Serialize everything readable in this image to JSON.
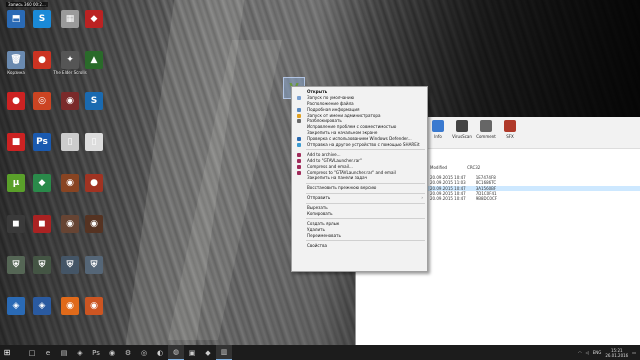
{
  "desktop": {
    "tooltip": "Запись 360 00:2...",
    "icons": [
      {
        "label": "",
        "color": "#2a6ab5",
        "glyph": "⬒"
      },
      {
        "label": "",
        "color": "#1a8ad8",
        "glyph": "S"
      },
      {
        "label": "",
        "color": "#9a9a9a",
        "glyph": "▦"
      },
      {
        "label": "",
        "color": "#bb2222",
        "glyph": "◆"
      },
      {
        "label": "Корзина",
        "color": "#6a8ab0",
        "glyph": "🗑"
      },
      {
        "label": "",
        "color": "#cc3322",
        "glyph": "●"
      },
      {
        "label": "The Elder Scrolls",
        "color": "#555",
        "glyph": "✦"
      },
      {
        "label": "",
        "color": "#2a6a2a",
        "glyph": "▲"
      },
      {
        "label": "",
        "color": "#cc2222",
        "glyph": "●"
      },
      {
        "label": "",
        "color": "#cc4422",
        "glyph": "◎"
      },
      {
        "label": "",
        "color": "#7a2a2a",
        "glyph": "◉"
      },
      {
        "label": "",
        "color": "#1a6ab0",
        "glyph": "S"
      },
      {
        "label": "",
        "color": "#cc2222",
        "glyph": "■"
      },
      {
        "label": "",
        "color": "#1a5ab0",
        "glyph": "Ps"
      },
      {
        "label": "",
        "color": "#cccccc",
        "glyph": "▯"
      },
      {
        "label": "",
        "color": "#dddddd",
        "glyph": "▯"
      },
      {
        "label": "",
        "color": "#5aa02a",
        "glyph": "μ"
      },
      {
        "label": "",
        "color": "#2a8a4a",
        "glyph": "◆"
      },
      {
        "label": "",
        "color": "#884422",
        "glyph": "◉"
      },
      {
        "label": "",
        "color": "#a03322",
        "glyph": "●"
      },
      {
        "label": "",
        "color": "#3a3a3a",
        "glyph": "◼"
      },
      {
        "label": "",
        "color": "#aa2222",
        "glyph": "◼"
      },
      {
        "label": "",
        "color": "#664433",
        "glyph": "◉"
      },
      {
        "label": "",
        "color": "#553322",
        "glyph": "◉"
      },
      {
        "label": "",
        "color": "#556655",
        "glyph": "⛨"
      },
      {
        "label": "",
        "color": "#445544",
        "glyph": "⛨"
      },
      {
        "label": "",
        "color": "#445566",
        "glyph": "⛨"
      },
      {
        "label": "",
        "color": "#556677",
        "glyph": "⛨"
      },
      {
        "label": "",
        "color": "#2a6ab5",
        "glyph": "◈"
      },
      {
        "label": "",
        "color": "#2a5aa0",
        "glyph": "◈"
      },
      {
        "label": "",
        "color": "#e06a1a",
        "glyph": "◉"
      },
      {
        "label": "",
        "color": "#cc5522",
        "glyph": "◉"
      }
    ]
  },
  "drag_ghost": {
    "glyph": "V"
  },
  "explorer": {
    "toolbar": [
      {
        "label": "Info",
        "color": "#3a7ad0"
      },
      {
        "label": "VirusScan",
        "color": "#444"
      },
      {
        "label": "Comment",
        "color": "#666"
      },
      {
        "label": "SFX",
        "color": "#b03a2a"
      }
    ],
    "columns": [
      "Modified",
      "CRC32"
    ],
    "rows": [
      {
        "date": "20.09.2015 10:47",
        "crc": "1E7474F8"
      },
      {
        "date": "20.09.2015 11:03",
        "crc": "0C1686TC"
      },
      {
        "date": "20.09.2015 10:47",
        "crc": "3A1560BF"
      },
      {
        "date": "20.09.2015 10:47",
        "crc": "7D1C0F41"
      },
      {
        "date": "20.09.2015 10:47",
        "crc": "9B8DC0CF"
      }
    ]
  },
  "context_menu": {
    "items": [
      {
        "label": "Открыть",
        "bold": true,
        "icon": ""
      },
      {
        "label": "Запуск по умолчанию",
        "icon": "#7aa0d0"
      },
      {
        "label": "Расположение файла",
        "icon": ""
      },
      {
        "label": "Подробная информация",
        "icon": "#5a8ac0"
      },
      {
        "label": "Запуск от имени администратора",
        "icon": "#e0a020"
      },
      {
        "label": "Разблокировать",
        "icon": "#6a6a6a"
      },
      {
        "label": "Исправление проблем с совместимостью",
        "icon": ""
      },
      {
        "label": "Закрепить на начальном экране",
        "icon": ""
      },
      {
        "label": "Проверка с использованием Windows Defender...",
        "icon": "#2a6ab0"
      },
      {
        "label": "Отправка на другое устройство с помощью SHAREit",
        "icon": "#3a9ad0"
      },
      {
        "sep": true
      },
      {
        "label": "Add to archive...",
        "icon": "#a02a5a"
      },
      {
        "label": "Add to \"GTAVLauncher.rar\"",
        "icon": "#a02a5a"
      },
      {
        "label": "Compress and email...",
        "icon": "#a02a5a"
      },
      {
        "label": "Compress to \"GTAVLauncher.rar\" and email",
        "icon": "#a02a5a"
      },
      {
        "label": "Закрепить на панели задач",
        "icon": ""
      },
      {
        "sep": true
      },
      {
        "label": "Восстановить прежнюю версию",
        "icon": ""
      },
      {
        "sep": true
      },
      {
        "label": "Отправить",
        "icon": "",
        "submenu": true
      },
      {
        "sep": true
      },
      {
        "label": "Вырезать",
        "icon": ""
      },
      {
        "label": "Копировать",
        "icon": ""
      },
      {
        "sep": true
      },
      {
        "label": "Создать ярлык",
        "icon": ""
      },
      {
        "label": "Удалить",
        "icon": ""
      },
      {
        "label": "Переименовать",
        "icon": ""
      },
      {
        "sep": true
      },
      {
        "label": "Свойства",
        "icon": ""
      }
    ]
  },
  "taskbar": {
    "start_glyph": "⊞",
    "items": [
      {
        "glyph": "□",
        "name": "task-view",
        "active": false
      },
      {
        "glyph": "e",
        "name": "edge",
        "active": false
      },
      {
        "glyph": "▤",
        "name": "file-explorer",
        "active": false
      },
      {
        "glyph": "◈",
        "name": "store",
        "active": false
      },
      {
        "glyph": "Ps",
        "name": "photoshop",
        "active": false
      },
      {
        "glyph": "◉",
        "name": "media",
        "active": false
      },
      {
        "glyph": "⚙",
        "name": "settings",
        "active": false
      },
      {
        "glyph": "◎",
        "name": "chrome",
        "active": false
      },
      {
        "glyph": "◐",
        "name": "app-1",
        "active": false
      },
      {
        "glyph": "◍",
        "name": "app-2",
        "active": true
      },
      {
        "glyph": "▣",
        "name": "app-3",
        "active": false
      },
      {
        "glyph": "◆",
        "name": "app-4",
        "active": false
      },
      {
        "glyph": "▥",
        "name": "winrar",
        "active": true
      }
    ],
    "tray": {
      "lang": "ENG",
      "time": "15:21",
      "date": "26.01.2016"
    }
  }
}
